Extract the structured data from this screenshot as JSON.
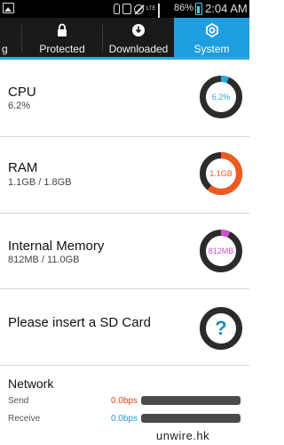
{
  "status_bar": {
    "battery_percent": "86%",
    "time": "2:04 AM",
    "network_type": "LTE",
    "icons": [
      "gallery-icon",
      "hand-icon",
      "nfc-icon",
      "mute-icon",
      "signal-icon",
      "battery-icon"
    ]
  },
  "tabs": [
    {
      "label": "g",
      "icon": "none",
      "active": false
    },
    {
      "label": "Protected",
      "icon": "lock-icon",
      "active": false
    },
    {
      "label": "Downloaded",
      "icon": "download-icon",
      "active": false
    },
    {
      "label": "System",
      "icon": "gear-icon",
      "active": true
    }
  ],
  "cpu": {
    "title": "CPU",
    "value": "6.2%",
    "gauge_text": "6.2%",
    "gauge_fraction": 0.062,
    "color": "#2aa8d8"
  },
  "ram": {
    "title": "RAM",
    "value": "1.1GB / 1.8GB",
    "gauge_text": "1.1GB",
    "gauge_fraction": 0.61,
    "color": "#f05a1e"
  },
  "internal_memory": {
    "title": "Internal Memory",
    "value": "812MB / 11.0GB",
    "gauge_text": "812MB",
    "gauge_fraction": 0.072,
    "color": "#d14fcf"
  },
  "sd_card": {
    "title": "Please insert a SD Card",
    "gauge_text": "?",
    "color": "#1c8fb8"
  },
  "network": {
    "title": "Network",
    "send_label": "Send",
    "send_value": "0.0bps",
    "send_color": "#e8401a",
    "receive_label": "Receive",
    "receive_value": "0.0bps",
    "receive_color": "#1e9ee0"
  },
  "watermark": "unwire.hk"
}
